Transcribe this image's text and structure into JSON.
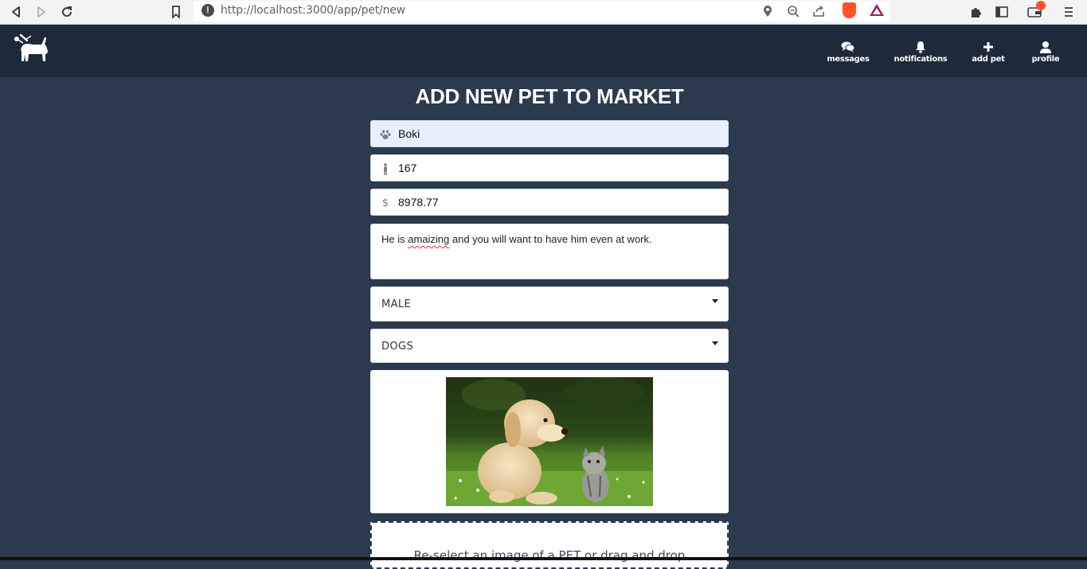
{
  "browser": {
    "url": "http://localhost:3000/app/pet/new",
    "back_icon": "back-arrow-icon",
    "forward_icon": "forward-arrow-icon",
    "reload_icon": "reload-icon"
  },
  "header": {
    "nav": [
      {
        "label": "messages",
        "icon": "chat-bubbles-icon"
      },
      {
        "label": "notifications",
        "icon": "bell-icon"
      },
      {
        "label": "add pet",
        "icon": "plus-icon"
      },
      {
        "label": "profile",
        "icon": "user-icon"
      }
    ]
  },
  "form": {
    "title": "ADD NEW PET TO MARKET",
    "name": {
      "value": "Boki",
      "icon": "paw-icon"
    },
    "height": {
      "value": "167",
      "icon": "person-icon"
    },
    "price": {
      "value": "8978.77",
      "icon": "dollar-icon"
    },
    "description": {
      "before": "He is ",
      "misspelled": "amaizing",
      "after": " and you will want to have him even at work."
    },
    "gender": {
      "selected": "MALE"
    },
    "category": {
      "selected": "DOGS"
    },
    "dropzone_text": "Re-select an image of a PET or drag and drop"
  },
  "colors": {
    "page_bg": "#2c3a4e",
    "header_bg": "#1c2a3c",
    "autofill_bg": "#e8f0fe"
  }
}
